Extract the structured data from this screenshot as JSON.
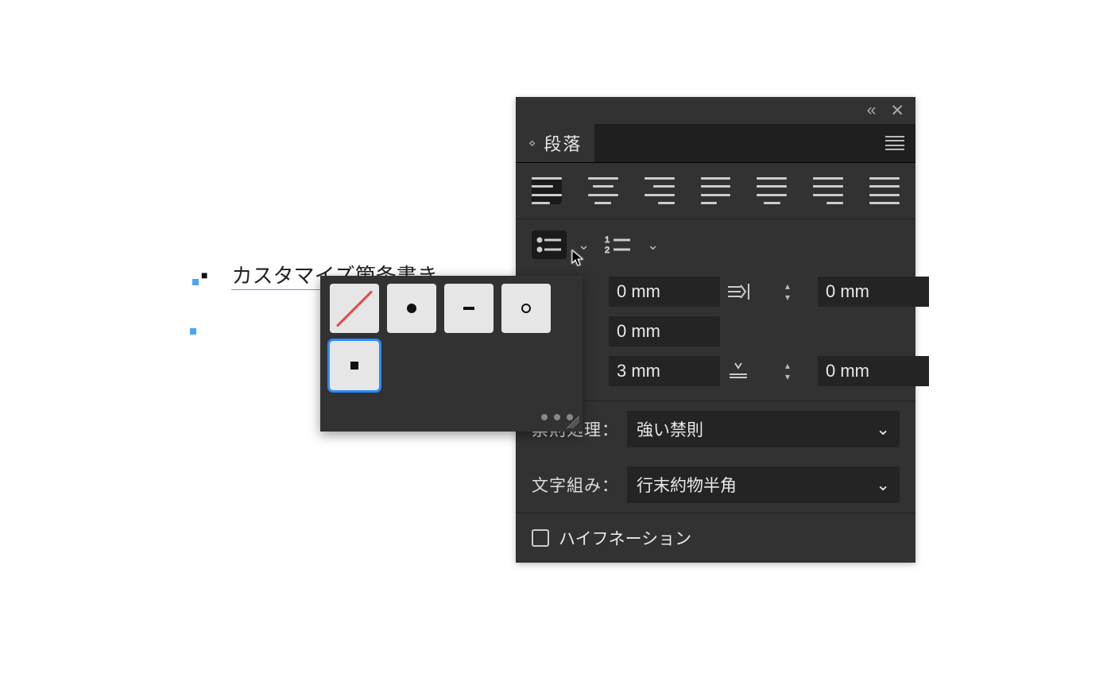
{
  "canvas": {
    "text": "カスタマイズ箇条書き"
  },
  "panel": {
    "title": "段落",
    "lists": {
      "bulleted_active": true
    },
    "indents": {
      "left": "0 mm",
      "right": "0 mm",
      "first_line": "0 mm",
      "bullet_indent": "3 mm",
      "after_bullet": "0 mm"
    },
    "kinsoku": {
      "label": "禁則処理：",
      "value": "強い禁則"
    },
    "mojikumi": {
      "label": "文字組み：",
      "value": "行末約物半角"
    },
    "hyphenation": {
      "label": "ハイフネーション",
      "checked": false
    }
  },
  "flyout": {
    "options": [
      "none",
      "disc",
      "dash",
      "circle",
      "square"
    ],
    "selected": "square"
  }
}
